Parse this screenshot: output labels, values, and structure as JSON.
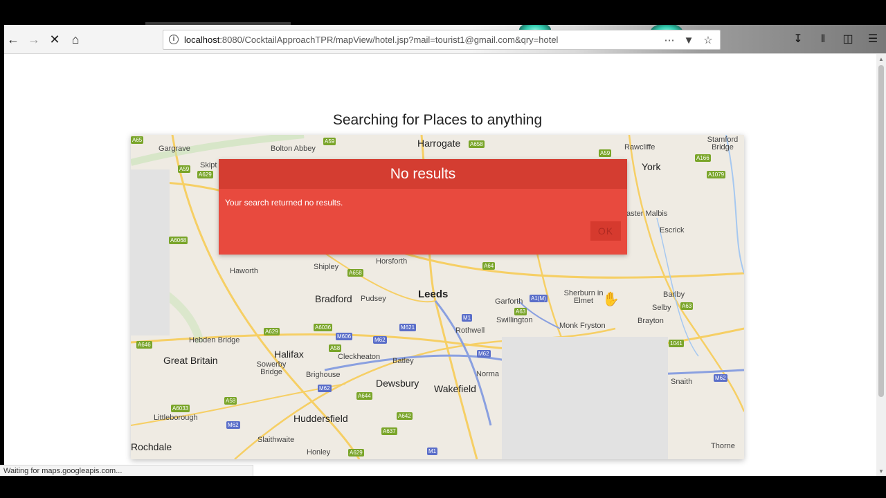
{
  "browser": {
    "url_host": "localhost",
    "url_rest": ":8080/CocktailApproachTPR/mapView/hotel.jsp?mail=tourist1@gmail.com&qry=hotel",
    "status_text": "Waiting for maps.googleapis.com..."
  },
  "page": {
    "title": "Searching for Places to anything"
  },
  "dialog": {
    "title": "No results",
    "message": "Your search returned no results.",
    "ok_label": "OK"
  },
  "map": {
    "labels": [
      {
        "text": "Gargrave",
        "cls": "lbl"
      },
      {
        "text": "Bolton Abbey",
        "cls": "lbl"
      },
      {
        "text": "Harrogate",
        "cls": "lbl city"
      },
      {
        "text": "Rawcliffe",
        "cls": "lbl"
      },
      {
        "text": "Stamford Bridge",
        "cls": "lbl"
      },
      {
        "text": "York",
        "cls": "lbl city"
      },
      {
        "text": "Skipt",
        "cls": "lbl"
      },
      {
        "text": "aster Malbis",
        "cls": "lbl"
      },
      {
        "text": "Escrick",
        "cls": "lbl"
      },
      {
        "text": "Haworth",
        "cls": "lbl"
      },
      {
        "text": "Shipley",
        "cls": "lbl"
      },
      {
        "text": "Horsforth",
        "cls": "lbl"
      },
      {
        "text": "Bradford",
        "cls": "lbl city"
      },
      {
        "text": "Pudsey",
        "cls": "lbl"
      },
      {
        "text": "Leeds",
        "cls": "lbl big"
      },
      {
        "text": "Garforth",
        "cls": "lbl"
      },
      {
        "text": "Sherburn in Elmet",
        "cls": "lbl"
      },
      {
        "text": "Barlby",
        "cls": "lbl"
      },
      {
        "text": "Selby",
        "cls": "lbl"
      },
      {
        "text": "Swillington",
        "cls": "lbl"
      },
      {
        "text": "Rothwell",
        "cls": "lbl"
      },
      {
        "text": "Monk Fryston",
        "cls": "lbl"
      },
      {
        "text": "Brayton",
        "cls": "lbl"
      },
      {
        "text": "Hebden Bridge",
        "cls": "lbl"
      },
      {
        "text": "Great Britain",
        "cls": "lbl city"
      },
      {
        "text": "Halifax",
        "cls": "lbl city"
      },
      {
        "text": "Cleckheaton",
        "cls": "lbl"
      },
      {
        "text": "Batley",
        "cls": "lbl"
      },
      {
        "text": "Sowerby Bridge",
        "cls": "lbl"
      },
      {
        "text": "Brighouse",
        "cls": "lbl"
      },
      {
        "text": "Dewsbury",
        "cls": "lbl city"
      },
      {
        "text": "Wakefield",
        "cls": "lbl city"
      },
      {
        "text": "Norma",
        "cls": "lbl"
      },
      {
        "text": "Snaith",
        "cls": "lbl"
      },
      {
        "text": "Littleborough",
        "cls": "lbl"
      },
      {
        "text": "Huddersfield",
        "cls": "lbl city"
      },
      {
        "text": "Rochdale",
        "cls": "lbl city"
      },
      {
        "text": "Slaithwaite",
        "cls": "lbl"
      },
      {
        "text": "Honley",
        "cls": "lbl"
      },
      {
        "text": "Thorne",
        "cls": "lbl"
      }
    ],
    "shields": [
      {
        "text": "A65",
        "type": "a"
      },
      {
        "text": "A59",
        "type": "a"
      },
      {
        "text": "A658",
        "type": "a"
      },
      {
        "text": "A59",
        "type": "a"
      },
      {
        "text": "A166",
        "type": "a"
      },
      {
        "text": "A1079",
        "type": "a"
      },
      {
        "text": "A59",
        "type": "a"
      },
      {
        "text": "A629",
        "type": "a"
      },
      {
        "text": "A6068",
        "type": "a"
      },
      {
        "text": "A658",
        "type": "a"
      },
      {
        "text": "A64",
        "type": "a"
      },
      {
        "text": "A1(M)",
        "type": "m"
      },
      {
        "text": "A63",
        "type": "a"
      },
      {
        "text": "A63",
        "type": "a"
      },
      {
        "text": "M1",
        "type": "m"
      },
      {
        "text": "M621",
        "type": "m"
      },
      {
        "text": "A6036",
        "type": "a"
      },
      {
        "text": "A629",
        "type": "a"
      },
      {
        "text": "M606",
        "type": "m"
      },
      {
        "text": "M62",
        "type": "m"
      },
      {
        "text": "A646",
        "type": "a"
      },
      {
        "text": "A58",
        "type": "a"
      },
      {
        "text": "M62",
        "type": "m"
      },
      {
        "text": "1041",
        "type": "a"
      },
      {
        "text": "M62",
        "type": "m"
      },
      {
        "text": "A644",
        "type": "a"
      },
      {
        "text": "A58",
        "type": "a"
      },
      {
        "text": "A6033",
        "type": "a"
      },
      {
        "text": "A642",
        "type": "a"
      },
      {
        "text": "M62",
        "type": "m"
      },
      {
        "text": "A637",
        "type": "a"
      },
      {
        "text": "A629",
        "type": "a"
      },
      {
        "text": "M1",
        "type": "m"
      },
      {
        "text": "M62",
        "type": "m"
      }
    ]
  }
}
